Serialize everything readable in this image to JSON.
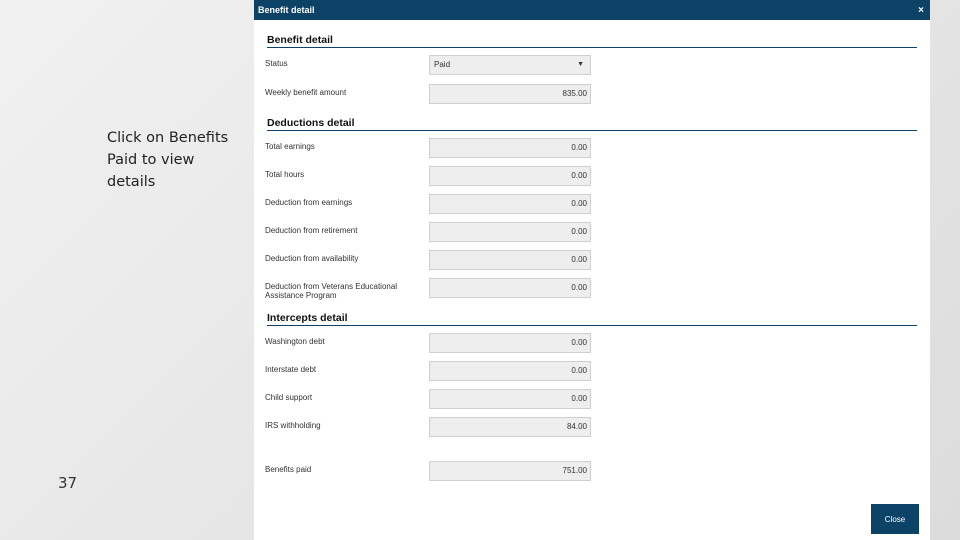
{
  "slide": {
    "note": "Click on Benefits Paid to view details",
    "page_number": "37"
  },
  "modal": {
    "title": "Benefit detail",
    "close_icon": "×",
    "close_button": "Close"
  },
  "benefit_detail": {
    "heading": "Benefit detail",
    "status_label": "Status",
    "status_value": "Paid",
    "weekly_label": "Weekly benefit amount",
    "weekly_value": "835.00"
  },
  "deductions": {
    "heading": "Deductions detail",
    "rows": [
      {
        "label": "Total earnings",
        "value": "0.00"
      },
      {
        "label": "Total hours",
        "value": "0.00"
      },
      {
        "label": "Deduction from earnings",
        "value": "0.00"
      },
      {
        "label": "Deduction from retirement",
        "value": "0.00"
      },
      {
        "label": "Deduction from availability",
        "value": "0.00"
      },
      {
        "label": "Deduction from Veterans Educational Assistance Program",
        "value": "0.00"
      }
    ]
  },
  "intercepts": {
    "heading": "Intercepts detail",
    "rows": [
      {
        "label": "Washington debt",
        "value": "0.00"
      },
      {
        "label": "Interstate debt",
        "value": "0.00"
      },
      {
        "label": "Child support",
        "value": "0.00"
      },
      {
        "label": "IRS withholding",
        "value": "84.00"
      }
    ]
  },
  "benefits_paid": {
    "label": "Benefits paid",
    "value": "751.00"
  },
  "colors": {
    "header": "#0c4266",
    "field_bg": "#eeeeee"
  },
  "icons": {
    "close": "close-icon",
    "dropdown": "chevron-down-icon"
  }
}
